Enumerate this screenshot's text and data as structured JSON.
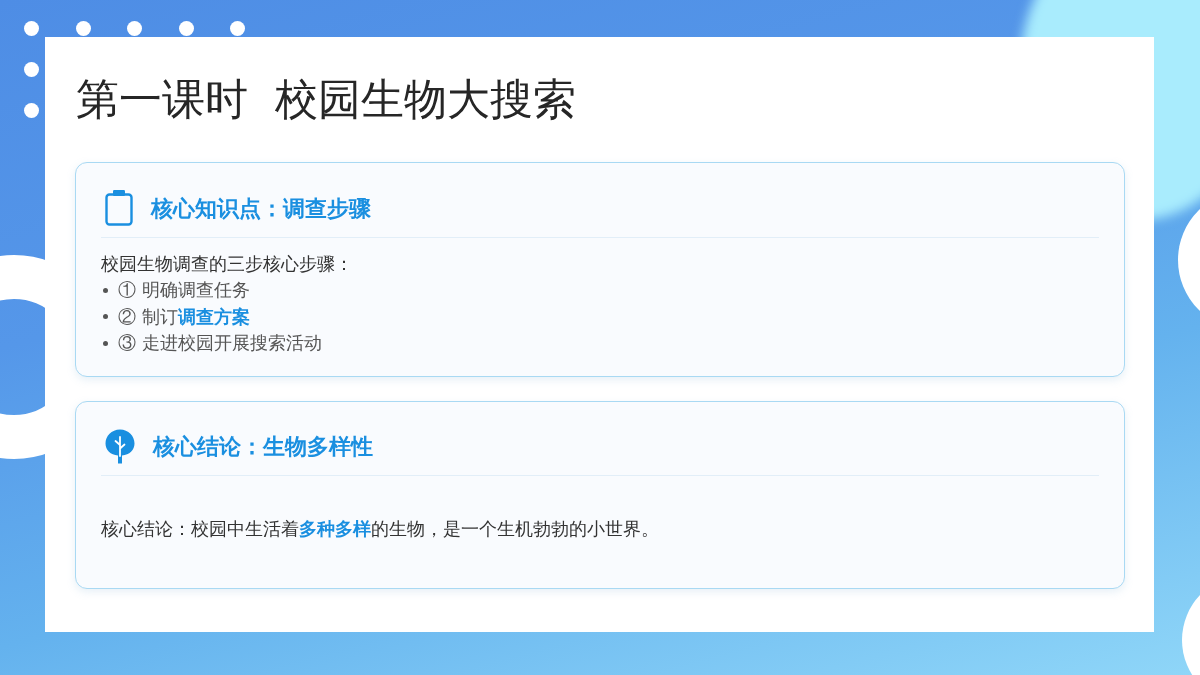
{
  "title": "第一课时  校园生物大搜索",
  "cards": [
    {
      "kind": "steps",
      "title": "核心知识点：调查步骤",
      "intro": "校园生物调查的三步核心步骤：",
      "items": [
        "① 明确调查任务",
        "② 制订**调查方案**",
        "③ 走进校园开展搜索活动"
      ]
    },
    {
      "kind": "conclusion",
      "title": "核心结论：生物多样性",
      "text": "核心结论：校园中生活着**多种多样**的生物，是一个生机勃勃的小世界。"
    }
  ]
}
